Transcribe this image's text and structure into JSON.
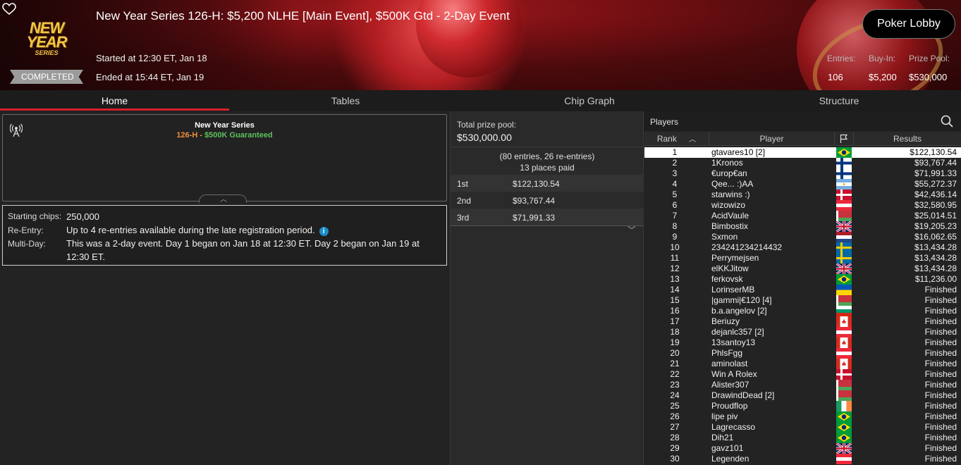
{
  "header": {
    "logo_line1": "NEW YEAR",
    "logo_line2": "SERIES",
    "status": "COMPLETED",
    "title": "New Year Series 126-H: $5,200 NLHE [Main Event], $500K Gtd - 2-Day Event",
    "started": "Started at 12:30 ET, Jan 18",
    "ended": "Ended at 15:44 ET, Jan 19",
    "lobby_button": "Poker Lobby",
    "stats": {
      "entries_label": "Entries:",
      "entries_value": "106",
      "buyin_label": "Buy-In:",
      "buyin_value": "$5,200",
      "prize_label": "Prize Pool:",
      "prize_value": "$530,000"
    }
  },
  "tabs": [
    {
      "label": "Home",
      "active": true
    },
    {
      "label": "Tables",
      "active": false
    },
    {
      "label": "Chip Graph",
      "active": false
    },
    {
      "label": "Structure",
      "active": false
    }
  ],
  "card": {
    "title": "New Year Series",
    "sub_orange": "126-H",
    "sub_sep": " - ",
    "sub_green": "$500K Guaranteed"
  },
  "details": {
    "starting_label": "Starting chips:",
    "starting_value": "250,000",
    "reentry_label": "Re-Entry:",
    "reentry_value": "Up to 4 re-entries available during the late registration period.",
    "multiday_label": "Multi-Day:",
    "multiday_value": "This was a 2-day event. Day 1 began on Jan 18 at 12:30 ET. Day 2 began on Jan 19 at 12:30 ET."
  },
  "prize": {
    "label": "Total prize pool:",
    "value": "$530,000.00",
    "entries": "(80 entries, 26 re-entries)",
    "places": "13 places paid",
    "payouts": [
      {
        "place": "1st",
        "amount": "$122,130.54"
      },
      {
        "place": "2nd",
        "amount": "$93,767.44"
      },
      {
        "place": "3rd",
        "amount": "$71,991.33"
      }
    ]
  },
  "players": {
    "title": "Players",
    "col_rank": "Rank",
    "col_player": "Player",
    "col_results": "Results",
    "rows": [
      {
        "rank": "1",
        "name": "gtavares10 [2]",
        "flag": "br",
        "result": "$122,130.54"
      },
      {
        "rank": "2",
        "name": "1Kronos",
        "flag": "fi",
        "result": "$93,767.44"
      },
      {
        "rank": "3",
        "name": "€urop€an",
        "flag": "fi",
        "result": "$71,991.33"
      },
      {
        "rank": "4",
        "name": "Qee... :)AA",
        "flag": "ar",
        "result": "$55,272.37"
      },
      {
        "rank": "5",
        "name": "starwins :)",
        "flag": "dk",
        "result": "$42,436.14"
      },
      {
        "rank": "6",
        "name": "wizowizo",
        "flag": "at",
        "result": "$32,580.95"
      },
      {
        "rank": "7",
        "name": "AcidVaule",
        "flag": "by",
        "result": "$25,014.51"
      },
      {
        "rank": "8",
        "name": "Bimbostix",
        "flag": "gb",
        "result": "$19,205.23"
      },
      {
        "rank": "9",
        "name": "Sxmon",
        "flag": "nl",
        "result": "$16,062.65"
      },
      {
        "rank": "10",
        "name": "234241234214432",
        "flag": "se",
        "result": "$13,434.28"
      },
      {
        "rank": "11",
        "name": "Perrymejsen",
        "flag": "se",
        "result": "$13,434.28"
      },
      {
        "rank": "12",
        "name": "elKKJitow",
        "flag": "gb",
        "result": "$13,434.28"
      },
      {
        "rank": "13",
        "name": "ferkovsk",
        "flag": "br",
        "result": "$11,236.00"
      },
      {
        "rank": "14",
        "name": "LorinserMB",
        "flag": "ua",
        "result": "Finished"
      },
      {
        "rank": "15",
        "name": "|gammi|€120 [4]",
        "flag": "by",
        "result": "Finished"
      },
      {
        "rank": "16",
        "name": "b.a.angelov [2]",
        "flag": "bg",
        "result": "Finished"
      },
      {
        "rank": "17",
        "name": "Beriuzy",
        "flag": "ca",
        "result": "Finished"
      },
      {
        "rank": "18",
        "name": "dejanlc357 [2]",
        "flag": "at",
        "result": "Finished"
      },
      {
        "rank": "19",
        "name": "13santoy13",
        "flag": "ca",
        "result": "Finished"
      },
      {
        "rank": "20",
        "name": "PhlsFgg",
        "flag": "at",
        "result": "Finished"
      },
      {
        "rank": "21",
        "name": "aminolast",
        "flag": "ca",
        "result": "Finished"
      },
      {
        "rank": "22",
        "name": "Win A Rolex",
        "flag": "dk",
        "result": "Finished"
      },
      {
        "rank": "23",
        "name": "Alister307",
        "flag": "by",
        "result": "Finished"
      },
      {
        "rank": "24",
        "name": "DrawindDead [2]",
        "flag": "by",
        "result": "Finished"
      },
      {
        "rank": "25",
        "name": "Proudflop",
        "flag": "ie",
        "result": "Finished"
      },
      {
        "rank": "26",
        "name": "lipe piv",
        "flag": "br",
        "result": "Finished"
      },
      {
        "rank": "27",
        "name": "Lagrecasso",
        "flag": "br",
        "result": "Finished"
      },
      {
        "rank": "28",
        "name": "Dih21",
        "flag": "br",
        "result": "Finished"
      },
      {
        "rank": "29",
        "name": "gavz101",
        "flag": "gb",
        "result": "Finished"
      },
      {
        "rank": "30",
        "name": "Legenden",
        "flag": "at",
        "result": "Finished"
      }
    ]
  },
  "colors": {
    "accent_red": "#d8202c",
    "highlight_orange": "#f0913a",
    "highlight_green": "#5cc15c",
    "info_blue": "#1a8dc7"
  }
}
